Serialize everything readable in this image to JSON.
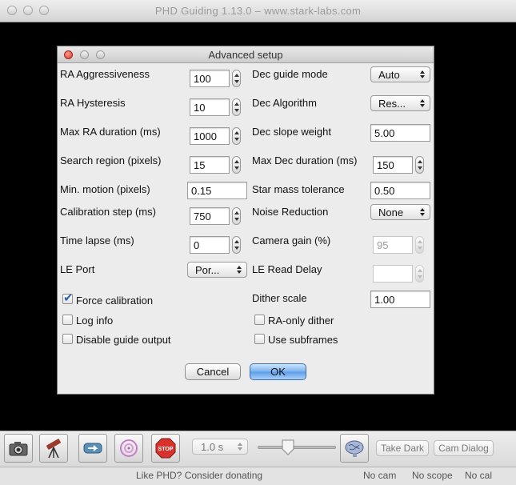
{
  "window": {
    "title": "PHD Guiding 1.13.0  –  www.stark-labs.com"
  },
  "dialog": {
    "title": "Advanced setup",
    "left": [
      {
        "label": "RA Aggressiveness",
        "value": "100",
        "kind": "spin"
      },
      {
        "label": "RA Hysteresis",
        "value": "10",
        "kind": "spin"
      },
      {
        "label": "Max RA duration (ms)",
        "value": "1000",
        "kind": "spin"
      },
      {
        "label": "Search region (pixels)",
        "value": "15",
        "kind": "spin"
      },
      {
        "label": "Min. motion (pixels)",
        "value": "0.15",
        "kind": "text"
      },
      {
        "label": "Calibration step (ms)",
        "value": "750",
        "kind": "spin"
      },
      {
        "label": "Time lapse (ms)",
        "value": "0",
        "kind": "spin"
      },
      {
        "label": "LE Port",
        "value": "Por...",
        "kind": "select"
      }
    ],
    "right": [
      {
        "label": "Dec guide mode",
        "value": "Auto",
        "kind": "select"
      },
      {
        "label": "Dec Algorithm",
        "value": "Res...",
        "kind": "select"
      },
      {
        "label": "Dec slope weight",
        "value": "5.00",
        "kind": "text"
      },
      {
        "label": "Max Dec duration (ms)",
        "value": "150",
        "kind": "spin"
      },
      {
        "label": "Star mass tolerance",
        "value": "0.50",
        "kind": "text"
      },
      {
        "label": "Noise Reduction",
        "value": "None",
        "kind": "select"
      },
      {
        "label": "Camera gain (%)",
        "value": "95",
        "kind": "spin-disabled"
      },
      {
        "label": "LE Read Delay",
        "value": "",
        "kind": "spin-disabled"
      },
      {
        "label": "Dither scale",
        "value": "1.00",
        "kind": "text"
      }
    ],
    "checkboxes_left": [
      {
        "label": "Force calibration",
        "checked": true
      },
      {
        "label": "Log info",
        "checked": false
      },
      {
        "label": "Disable guide output",
        "checked": false
      }
    ],
    "checkboxes_right": [
      {
        "label": "RA-only dither",
        "checked": false
      },
      {
        "label": "Use subframes",
        "checked": false
      }
    ],
    "cancel_label": "Cancel",
    "ok_label": "OK"
  },
  "toolbar": {
    "icons": [
      "camera-icon",
      "telescope-icon",
      "loop-icon",
      "target-icon",
      "stop-icon"
    ],
    "exposure": "1.0 s",
    "brain_icon": "brain-icon",
    "take_dark_label": "Take Dark",
    "cam_dialog_label": "Cam Dialog"
  },
  "status": {
    "message": "Like PHD? Consider donating",
    "cam": "No cam",
    "scope": "No scope",
    "cal": "No cal"
  },
  "colors": {
    "accent": "#5c9ce6",
    "stop_red": "#d8332a",
    "check": "#2f5fb0"
  }
}
